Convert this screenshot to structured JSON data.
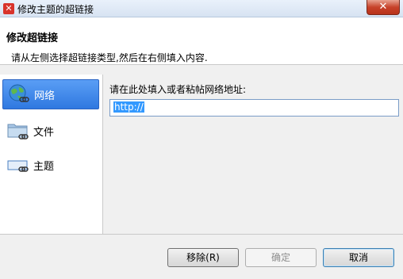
{
  "window": {
    "title": "修改主题的超链接",
    "app_icon": "xmind-x-icon",
    "close_label": "✕"
  },
  "header": {
    "title": "修改超链接",
    "subtitle": "请从左侧选择超链接类型,然后在右侧填入内容."
  },
  "sidebar": {
    "items": [
      {
        "label": "网络",
        "icon": "globe-link-icon",
        "selected": true
      },
      {
        "label": "文件",
        "icon": "folder-link-icon",
        "selected": false
      },
      {
        "label": "主题",
        "icon": "topic-link-icon",
        "selected": false
      }
    ]
  },
  "content": {
    "prompt": "请在此处填入或者粘帖网络地址:",
    "url_value": "http://"
  },
  "buttons": {
    "remove": "移除(R)",
    "ok": "确定",
    "cancel": "取消"
  },
  "colors": {
    "selection": "#3b85e8",
    "close": "#c7432b"
  }
}
